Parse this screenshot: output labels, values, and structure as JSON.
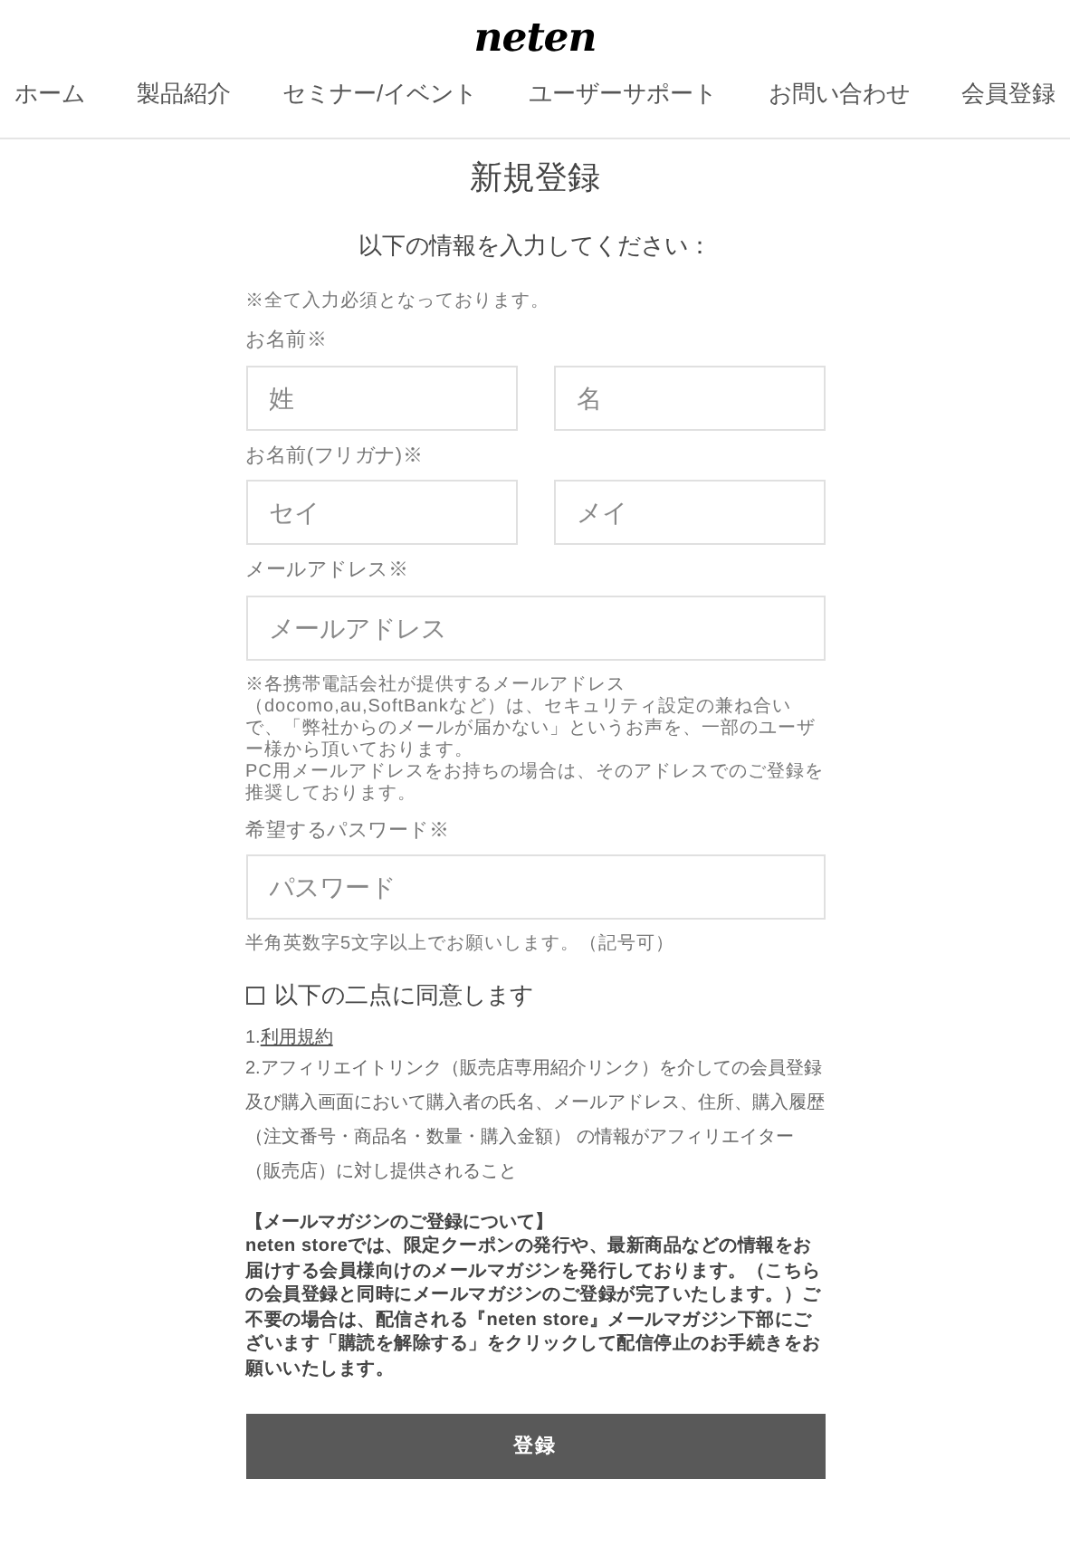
{
  "logo": "neten",
  "nav": [
    {
      "label": "ホーム"
    },
    {
      "label": "製品紹介"
    },
    {
      "label": "セミナー/イベント"
    },
    {
      "label": "ユーザーサポート"
    },
    {
      "label": "お問い合わせ"
    },
    {
      "label": "会員登録"
    }
  ],
  "title": "新規登録",
  "subtitle": "以下の情報を入力してください：",
  "required_note": "※全て入力必須となっております。",
  "fields": [
    {
      "label": "お名前※",
      "inputs": [
        {
          "placeholder": "姓"
        },
        {
          "placeholder": "名"
        }
      ]
    },
    {
      "label": "お名前(フリガナ)※",
      "inputs": [
        {
          "placeholder": "セイ"
        },
        {
          "placeholder": "メイ"
        }
      ]
    },
    {
      "label": "メールアドレス※",
      "inputs": [
        {
          "placeholder": "メールアドレス"
        }
      ],
      "note": "※各携帯電話会社が提供するメールアドレス（docomo,au,SoftBankなど）は、セキュリティ設定の兼ね合いで、「弊社からのメールが届かない」というお声を、一部のユーザー様から頂いております。\nPC用メールアドレスをお持ちの場合は、そのアドレスでのご登録を推奨しております。"
    },
    {
      "label": "希望するパスワード※",
      "inputs": [
        {
          "placeholder": "パスワード"
        }
      ],
      "note": "半角英数字5文字以上でお願いします。（記号可）"
    }
  ],
  "agreement": {
    "label": "以下の二点に同意します",
    "checked": false,
    "link_prefix": "1.",
    "link": "利用規約",
    "item_2": "2.アフィリエイトリンク（販売店専用紹介リンク）を介しての会員登録及び購入画面において購入者の氏名、メールアドレス、住所、購入履歴（注文番号・商品名・数量・購入金額） の情報がアフィリエイター（販売店）に対し提供されること"
  },
  "newsletter": {
    "heading": "【メールマガジンのご登録について】",
    "body": "neten storeでは、限定クーポンの発行や、最新商品などの情報をお届けする会員様向けのメールマガジンを発行しております。（こちらの会員登録と同時にメールマガジンのご登録が完了いたします。）ご不要の場合は、配信される『neten store』メールマガジン下部にございます「購読を解除する」をクリックして配信停止のお手続きをお願いいたします。"
  },
  "submit": "登録"
}
